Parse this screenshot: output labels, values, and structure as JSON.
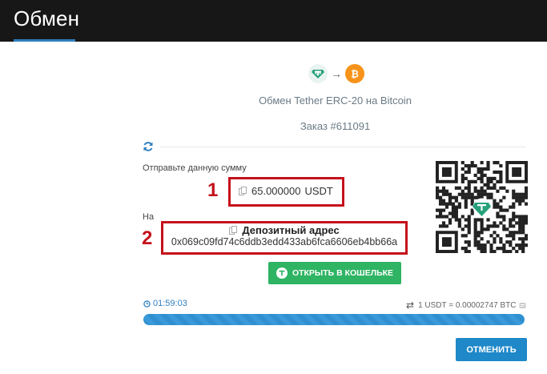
{
  "header": {
    "title": "Обмен"
  },
  "exchange": {
    "from_icon": "tether-icon",
    "to_icon": "bitcoin-icon",
    "arrow": "→",
    "subtitle": "Обмен Tether ERC-20 на Bitcoin",
    "order": "Заказ #611091"
  },
  "send": {
    "label": "Отправьте данную сумму",
    "amount": "65.000000",
    "unit": "USDT"
  },
  "destination": {
    "label": "На",
    "title": "Депозитный адрес",
    "address": "0x069c09fd74c6ddb3edd433ab6fca6606eb4bb66a"
  },
  "annotations": {
    "n1": "1",
    "n2": "2"
  },
  "wallet_button": {
    "label": "ОТКРЫТЬ В КОШЕЛЬКЕ"
  },
  "timer": {
    "value": "01:59:03"
  },
  "rate": {
    "swap": "⇄",
    "text": "1 USDT = 0.00002747 BTC"
  },
  "progress": {
    "percent": 100
  },
  "cancel_button": {
    "label": "ОТМЕНИТЬ"
  },
  "colors": {
    "brand": "#2f7fbf",
    "wallet_green": "#2eb463",
    "annotation_red": "#c4121b",
    "header_bg": "#171717"
  }
}
